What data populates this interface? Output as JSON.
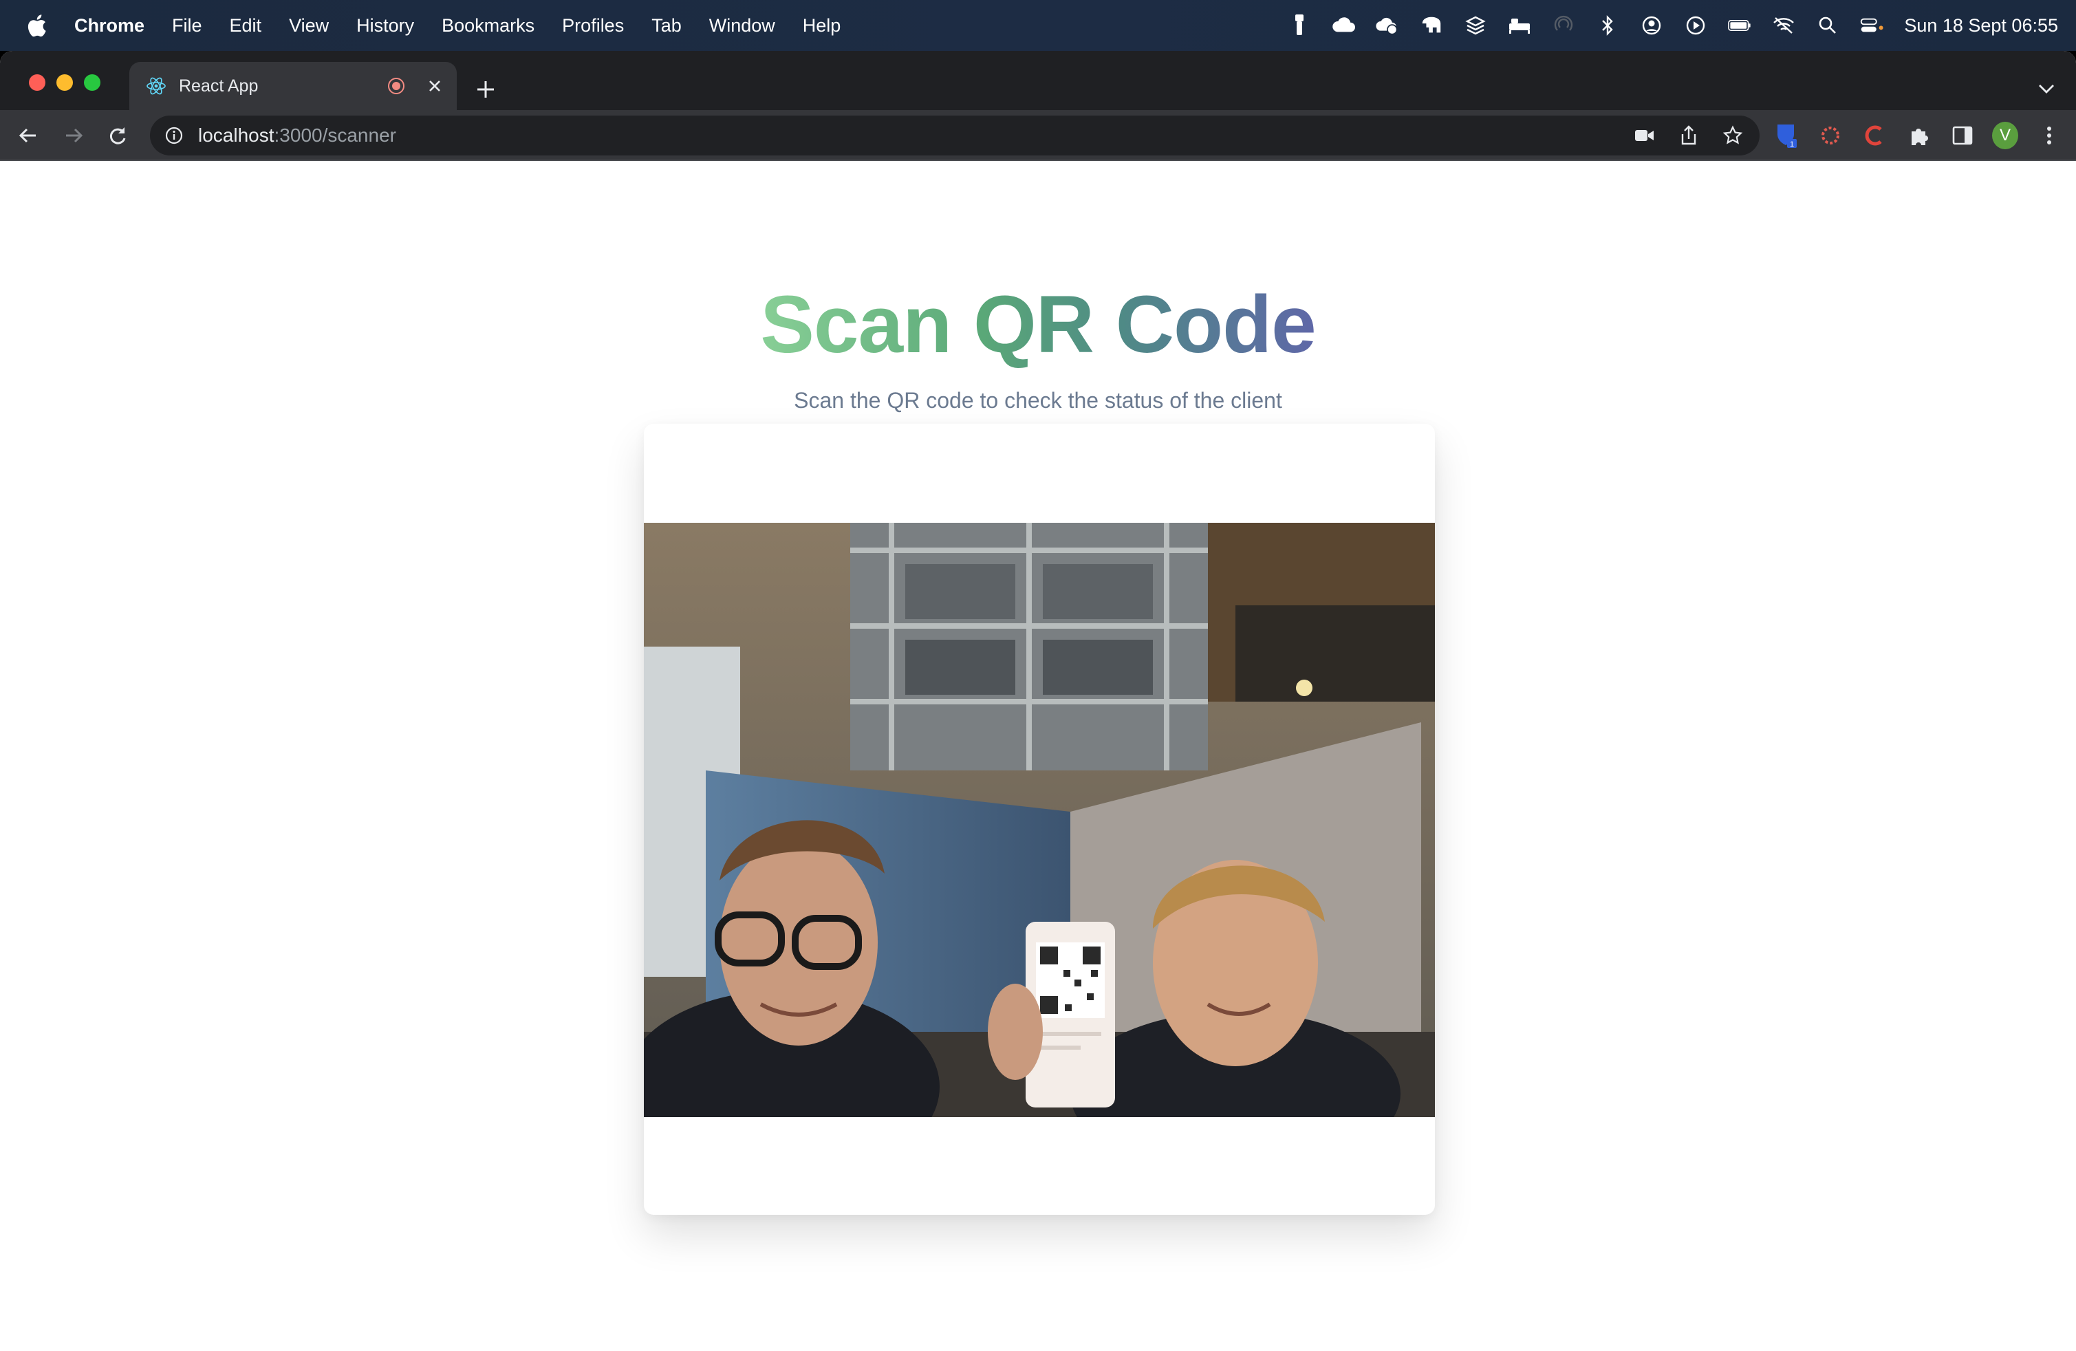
{
  "menubar": {
    "app_name": "Chrome",
    "items": [
      "File",
      "Edit",
      "View",
      "History",
      "Bookmarks",
      "Profiles",
      "Tab",
      "Window",
      "Help"
    ],
    "clock": "Sun 18 Sept  06:55"
  },
  "browser": {
    "tab_title": "React App",
    "url_host": "localhost",
    "url_path": ":3000/scanner",
    "avatar_letter": "V",
    "extension_badge": "1"
  },
  "page": {
    "title": "Scan QR Code",
    "subtitle": "Scan the QR code to check the status of the client",
    "title_gradient": [
      "#88cf96",
      "#5aa878",
      "#4f8a86",
      "#5f67a8"
    ]
  },
  "colors": {
    "menubar_bg": "#1b2a3f",
    "tabstrip_bg": "#1f2023",
    "toolbar_bg": "#35363a",
    "subtitle": "#6b7a90"
  }
}
